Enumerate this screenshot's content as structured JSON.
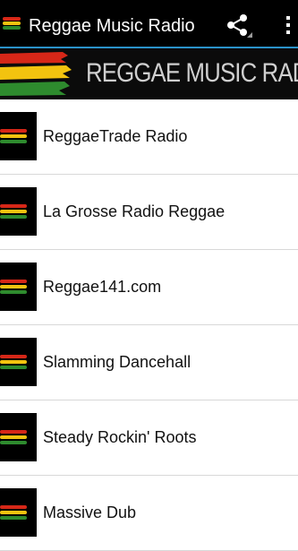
{
  "app": {
    "title": "Reggae Music Radio",
    "banner_text": "REGGAE MUSIC RADIO",
    "actions": {
      "share_icon": "share-icon",
      "overflow_icon": "overflow-menu-icon"
    }
  },
  "colors": {
    "action_bar": "#000000",
    "accent_line": "#2a92c9",
    "flag_red": "#d62718",
    "flag_yellow": "#f2c30f",
    "flag_green": "#2e8b2e"
  },
  "stations": [
    {
      "name": "ReggaeTrade Radio"
    },
    {
      "name": "La Grosse Radio Reggae"
    },
    {
      "name": "Reggae141.com"
    },
    {
      "name": "Slamming Dancehall"
    },
    {
      "name": "Steady Rockin' Roots"
    },
    {
      "name": "Massive Dub"
    }
  ]
}
